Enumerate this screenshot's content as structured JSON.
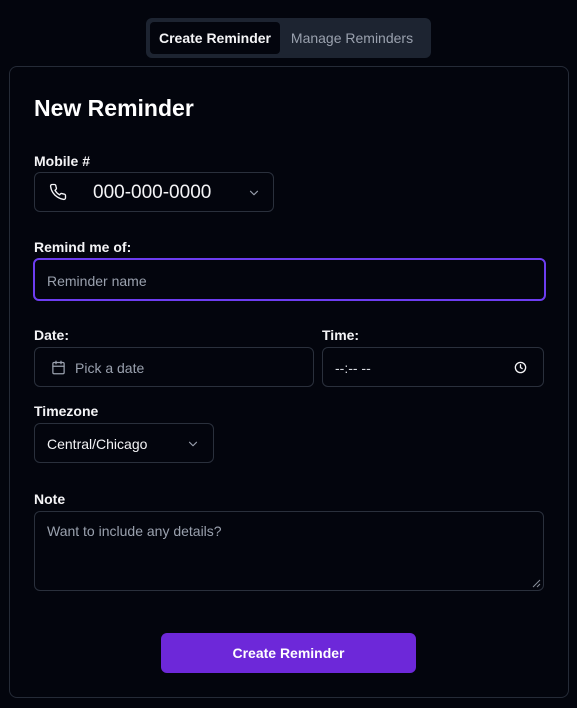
{
  "tabs": {
    "create_label": "Create Reminder",
    "manage_label": "Manage Reminders"
  },
  "form": {
    "title": "New Reminder",
    "mobile_label": "Mobile #",
    "mobile_value": "000-000-0000",
    "remind_label": "Remind me of:",
    "remind_placeholder": "Reminder name",
    "date_label": "Date:",
    "date_placeholder": "Pick a date",
    "time_label": "Time:",
    "time_value": "--:-- --",
    "timezone_label": "Timezone",
    "timezone_value": "Central/Chicago",
    "note_label": "Note",
    "note_placeholder": "Want to include any details?",
    "submit_label": "Create Reminder"
  },
  "colors": {
    "accent": "#6d28d9",
    "focus_ring": "#6d3df0",
    "background": "#03050d"
  },
  "icons": [
    "phone-icon",
    "chevron-down-icon",
    "calendar-icon",
    "clock-icon",
    "resize-handle-icon"
  ]
}
